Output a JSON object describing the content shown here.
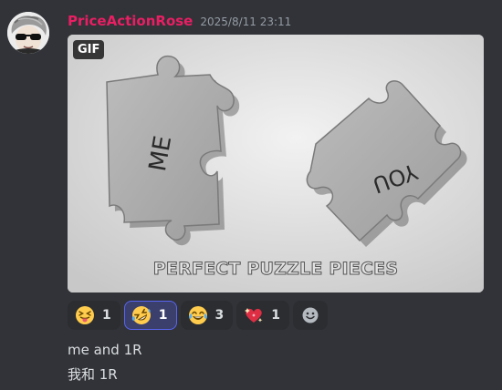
{
  "author": {
    "username": "PriceActionRose",
    "username_color": "#e91e63",
    "timestamp": "2025/8/11 23:11"
  },
  "gif": {
    "badge": "GIF",
    "caption": "PERFECT PUZZLE PIECES",
    "piece_left_text": "ME",
    "piece_right_text": "YOU"
  },
  "reactions": [
    {
      "emoji": "squinting-face-with-tongue",
      "count": "1",
      "active": false
    },
    {
      "emoji": "rolling-on-the-floor-laughing",
      "count": "1",
      "active": true
    },
    {
      "emoji": "face-with-tears-of-joy",
      "count": "3",
      "active": false
    },
    {
      "emoji": "sparkling-heart",
      "count": "1",
      "active": false
    }
  ],
  "add_reaction_icon": "add-reaction-smiley-icon",
  "message_lines": [
    "me and 1R",
    "我和 1R"
  ],
  "colors": {
    "background": "#313338",
    "reaction_bg": "#2b2d31",
    "reaction_active_border": "#5865f2",
    "text": "#dbdee1",
    "muted": "#949ba4"
  }
}
